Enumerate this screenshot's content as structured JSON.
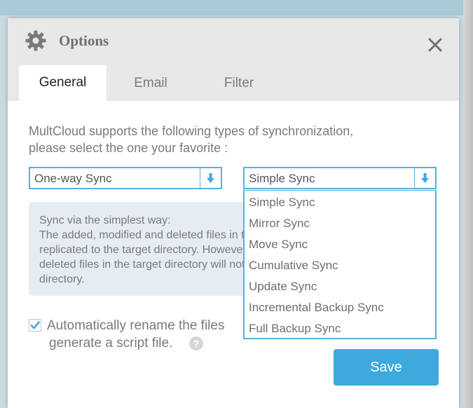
{
  "dialog": {
    "title": "Options",
    "icon": "gear-icon",
    "close_icon": "close-icon"
  },
  "tabs": [
    {
      "label": "General",
      "active": true
    },
    {
      "label": "Email",
      "active": false
    },
    {
      "label": "Filter",
      "active": false
    }
  ],
  "general": {
    "intro_line1": "MultCloud supports the following types of synchronization,",
    "intro_line2": "please select the one your favorite :",
    "direction_select": {
      "selected": "One-way Sync"
    },
    "mode_select": {
      "selected": "Simple Sync",
      "options": [
        "Simple Sync",
        "Mirror Sync",
        "Move Sync",
        "Cumulative Sync",
        "Update Sync",
        "Incremental Backup Sync",
        "Full Backup Sync"
      ]
    },
    "description_lines": [
      "Sync via the simplest way:",
      "The added, modified and deleted files in the source directory will be",
      "replicated to the target directory. However, the added, modified and",
      "deleted files in the target directory will not be synced to the source",
      "directory."
    ],
    "rename_checkbox": {
      "checked": true,
      "label_line1": "Automatically rename the files",
      "label_line2": "generate a script file."
    },
    "help_glyph": "?"
  },
  "buttons": {
    "save": "Save"
  },
  "colors": {
    "accent": "#3ea9dc",
    "select_border": "#56b3d7",
    "header_bg": "#e8e8e8",
    "description_bg": "#e6edf2",
    "text_gray": "#7a7a7a"
  }
}
